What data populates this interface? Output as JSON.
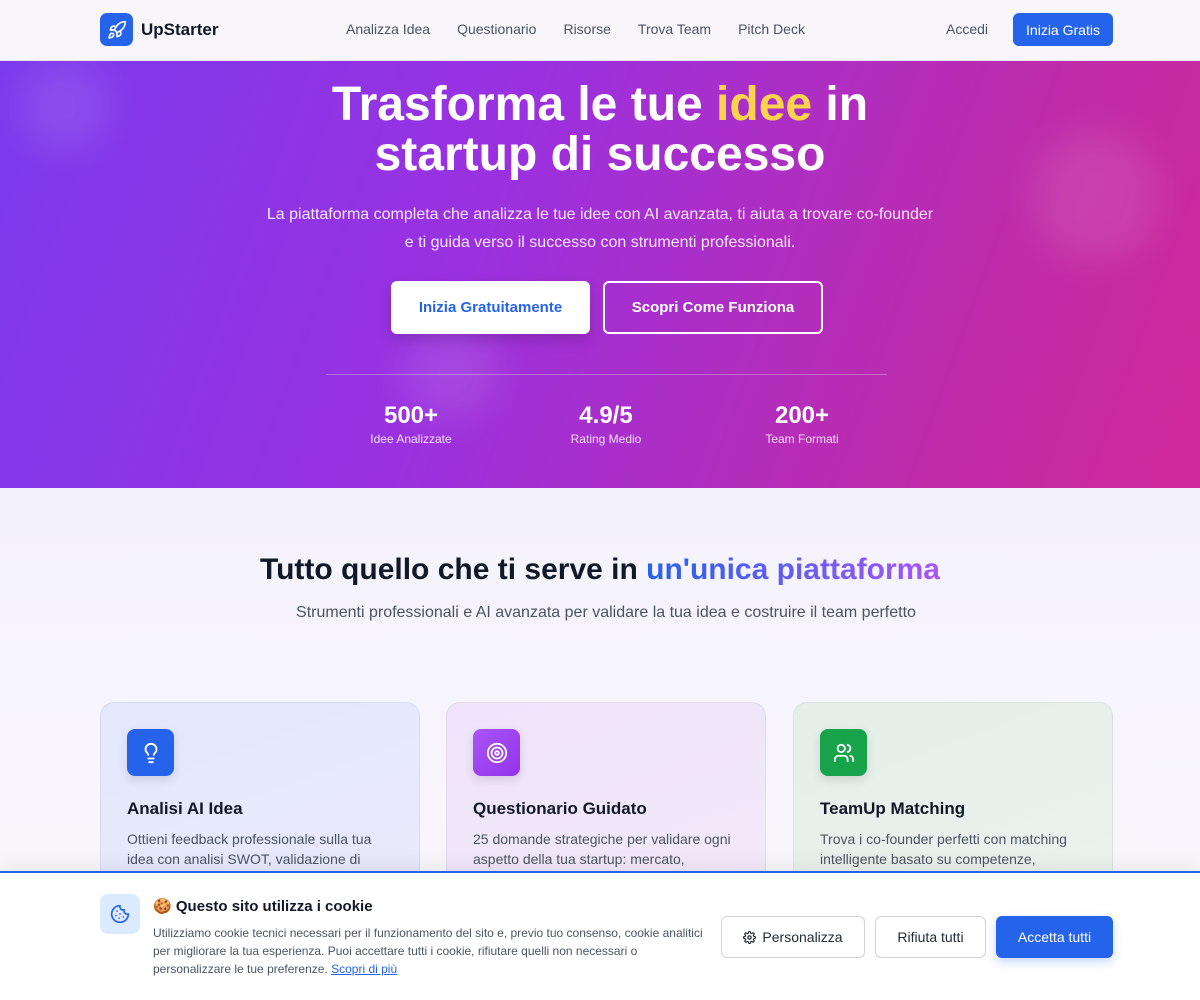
{
  "nav": {
    "brand": "UpStarter",
    "links": [
      "Analizza Idea",
      "Questionario",
      "Risorse",
      "Trova Team",
      "Pitch Deck"
    ],
    "login": "Accedi",
    "cta": "Inizia Gratis"
  },
  "hero": {
    "title_pre": "Trasforma le tue ",
    "title_highlight": "idee",
    "title_post": " in",
    "title_line2": "startup di successo",
    "subtitle_line1": "La piattaforma completa che analizza le tue idee con AI avanzata, ti aiuta a trovare co-founder",
    "subtitle_line2": "e ti guida verso il successo con strumenti professionali.",
    "primary_cta": "Inizia Gratuitamente",
    "secondary_cta": "Scopri Come Funziona",
    "stats": [
      {
        "value": "500+",
        "label": "Idee Analizzate"
      },
      {
        "value": "4.9/5",
        "label": "Rating Medio"
      },
      {
        "value": "200+",
        "label": "Team Formati"
      }
    ],
    "highlight_color": "#fcd34d"
  },
  "features": {
    "title_pre": "Tutto quello che ti serve in ",
    "title_highlight": "un'unica piattaforma",
    "subtitle": "Strumenti professionali e AI avanzata per validare la tua idea e costruire il team perfetto",
    "cards": [
      {
        "icon": "lightbulb-icon",
        "title": "Analisi AI Idea",
        "desc": "Ottieni feedback professionale sulla tua idea con analisi SWOT, validazione di",
        "color": "#2563eb"
      },
      {
        "icon": "target-icon",
        "title": "Questionario Guidato",
        "desc": "25 domande strategiche per validare ogni aspetto della tua startup: mercato,",
        "color": "#9333ea"
      },
      {
        "icon": "users-icon",
        "title": "TeamUp Matching",
        "desc": "Trova i co-founder perfetti con matching intelligente basato su competenze,",
        "color": "#16a34a"
      }
    ]
  },
  "cookie": {
    "emoji": "🍪",
    "title": "Questo sito utilizza i cookie",
    "text": "Utilizziamo cookie tecnici necessari per il funzionamento del sito e, previo tuo consenso, cookie analitici per migliorare la tua esperienza. Puoi accettare tutti i cookie, rifiutare quelli non necessari o personalizzare le tue preferenze. ",
    "link": "Scopri di più",
    "customize": "Personalizza",
    "reject": "Rifiuta tutti",
    "accept": "Accetta tutti"
  },
  "colors": {
    "accent": "#2563eb",
    "hero_start": "#7c3aed",
    "hero_end": "#d0289a"
  }
}
